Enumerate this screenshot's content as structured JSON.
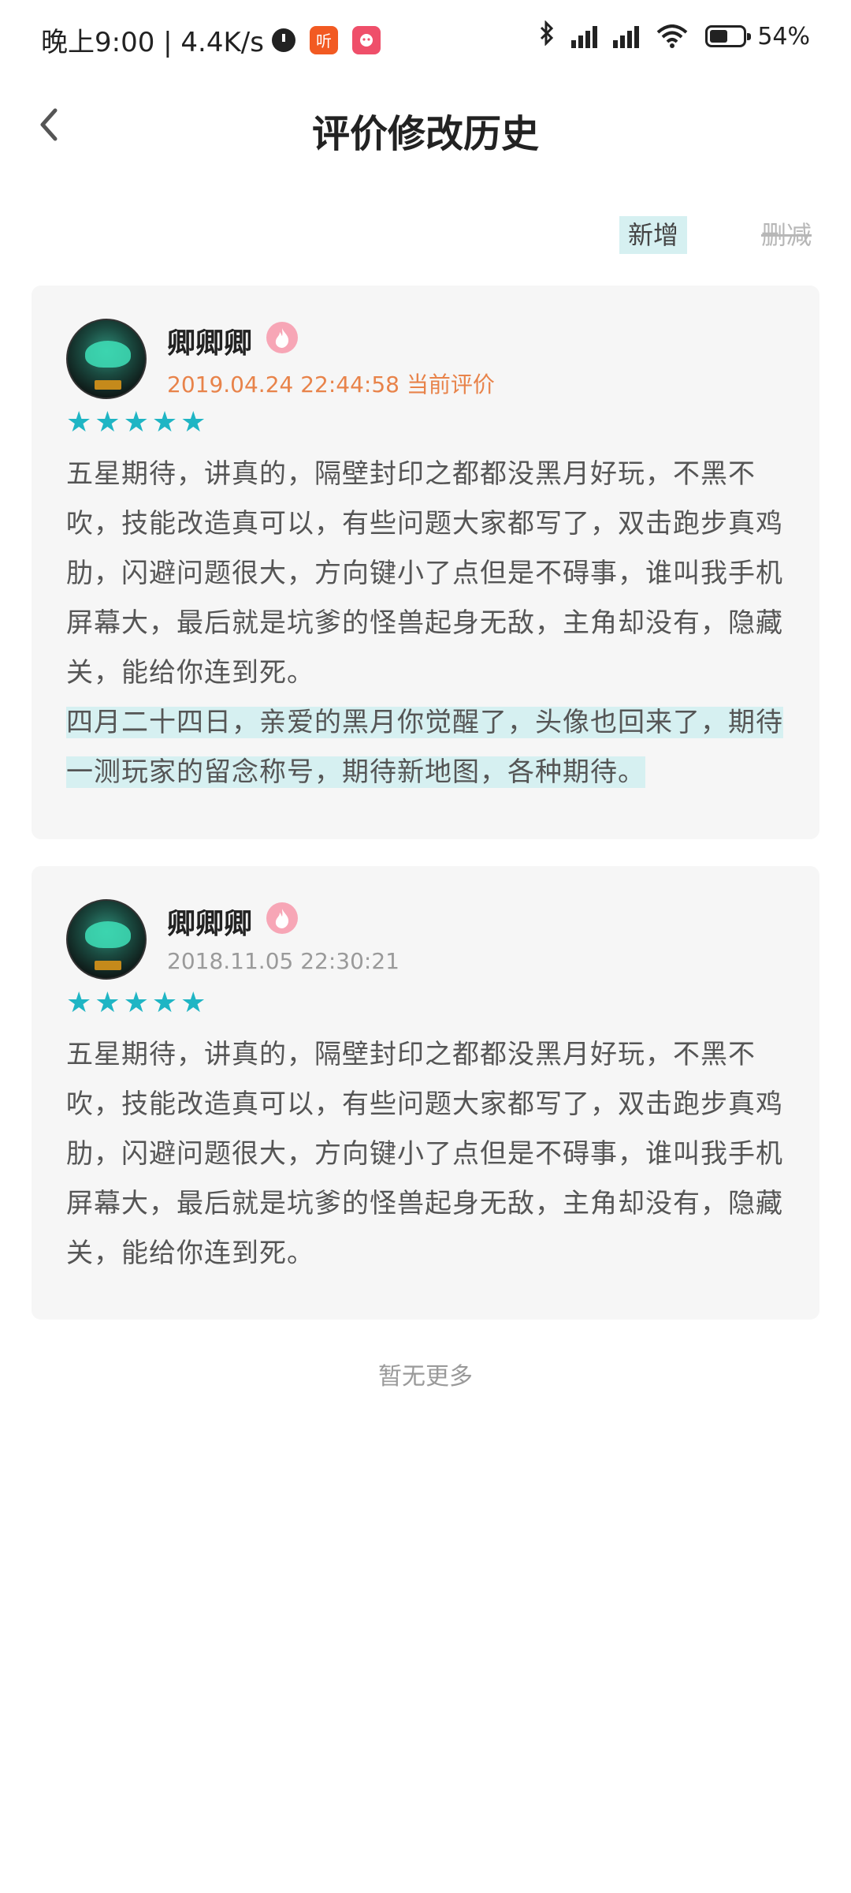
{
  "status_bar": {
    "time_speed": "晚上9:00 | 4.4K/s",
    "app_icon_1_label": "听",
    "app_icon_1_color": "#f25a22",
    "app_icon_2_color": "#ef4f6a",
    "battery_percent": "54%",
    "icons": [
      "alarm-icon",
      "bluetooth-icon",
      "signal-icon",
      "signal-icon",
      "wifi-icon",
      "battery-icon"
    ]
  },
  "header": {
    "title": "评价修改历史",
    "back_icon": "chevron-left-icon"
  },
  "legend": {
    "added": "新增",
    "removed": "删减",
    "added_color": "#d6f0f1",
    "removed_color": "#b7b7b7"
  },
  "reviews": [
    {
      "user_name": "卿卿卿",
      "badge_icon": "flame-badge-icon",
      "timestamp": "2019.04.24 22:44:58 当前评价",
      "is_current": true,
      "rating": 5,
      "text": "五星期待，讲真的，隔壁封印之都都没黑月好玩，不黑不吹，技能改造真可以，有些问题大家都写了，双击跑步真鸡肋，闪避问题很大，方向键小了点但是不碍事，谁叫我手机屏幕大，最后就是坑爹的怪兽起身无敌，主角却没有，隐藏关，能给你连到死。",
      "added_text": "四月二十四日，亲爱的黑月你觉醒了，头像也回来了，期待一测玩家的留念称号，期待新地图，各种期待。"
    },
    {
      "user_name": "卿卿卿",
      "badge_icon": "flame-badge-icon",
      "timestamp": "2018.11.05 22:30:21",
      "is_current": false,
      "rating": 5,
      "text": "五星期待，讲真的，隔壁封印之都都没黑月好玩，不黑不吹，技能改造真可以，有些问题大家都写了，双击跑步真鸡肋，闪避问题很大，方向键小了点但是不碍事，谁叫我手机屏幕大，最后就是坑爹的怪兽起身无敌，主角却没有，隐藏关，能给你连到死。"
    }
  ],
  "footer": {
    "no_more": "暂无更多"
  },
  "colors": {
    "star": "#1fb5c4",
    "current_timestamp": "#e8834a",
    "card_background": "#f6f6f6"
  }
}
